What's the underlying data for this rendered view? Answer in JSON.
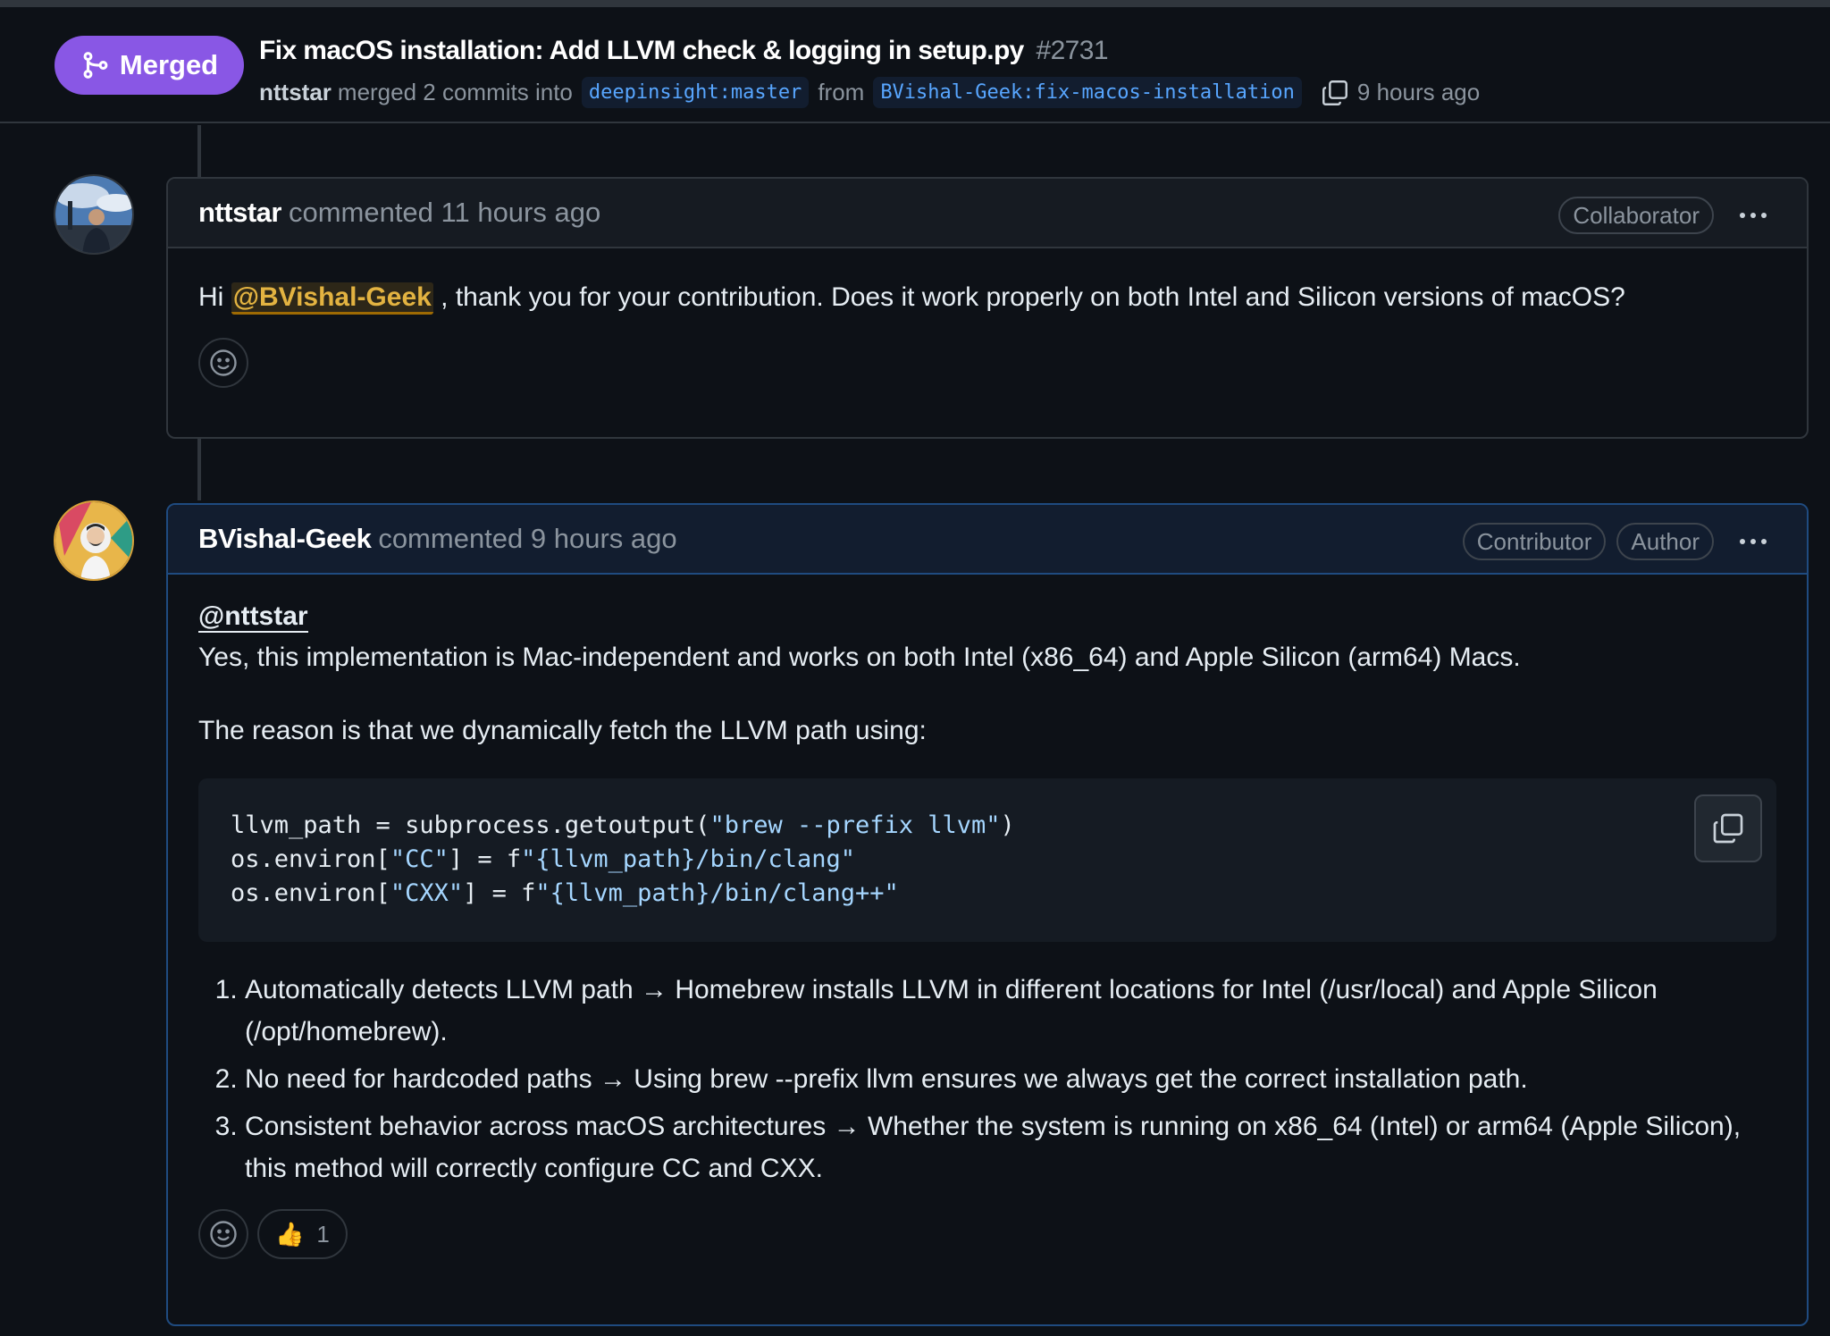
{
  "pr": {
    "status": "Merged",
    "title": "Fix macOS installation: Add LLVM check & logging in setup.py",
    "number": "#2731",
    "actor": "nttstar",
    "merged_text": "merged 2 commits into",
    "base_branch": "deepinsight:master",
    "from_text": "from",
    "head_branch": "BVishal-Geek:fix-macos-installation",
    "time": "9 hours ago"
  },
  "comments": [
    {
      "author": "nttstar",
      "verb": "commented 11 hours ago",
      "badges": [
        "Collaborator"
      ],
      "greeting": "Hi",
      "mention": "@BVishal-Geek",
      "text": ", thank you for your contribution. Does it work properly on both Intel and Silicon versions of macOS?"
    },
    {
      "author": "BVishal-Geek",
      "verb": "commented 9 hours ago",
      "badges": [
        "Contributor",
        "Author"
      ],
      "mention": "@nttstar",
      "line1": "Yes, this implementation is Mac-independent and works on both Intel (x86_64) and Apple Silicon (arm64) Macs.",
      "line2": "The reason is that we dynamically fetch the LLVM path using:",
      "code": {
        "l1_a": "llvm_path = subprocess.getoutput(",
        "l1_s": "\"brew --prefix llvm\"",
        "l1_b": ")",
        "l2_a": "os.environ[",
        "l2_s1": "\"CC\"",
        "l2_b": "] = f",
        "l2_s2": "\"{llvm_path}/bin/clang\"",
        "l3_a": "os.environ[",
        "l3_s1": "\"CXX\"",
        "l3_b": "] = f",
        "l3_s2": "\"{llvm_path}/bin/clang++\""
      },
      "points": [
        "Automatically detects LLVM path → Homebrew installs LLVM in different locations for Intel (/usr/local) and Apple Silicon (/opt/homebrew).",
        "No need for hardcoded paths → Using brew --prefix llvm ensures we always get the correct installation path.",
        "Consistent behavior across macOS architectures → Whether the system is running on x86_64 (Intel) or arm64 (Apple Silicon), this method will correctly configure CC and CXX."
      ],
      "reaction": {
        "emoji": "👍",
        "count": "1"
      }
    }
  ],
  "colors": {
    "merged": "#8957e5",
    "branch_text": "#58a6ff",
    "mention": "#e3b341",
    "background": "#0d1117"
  },
  "icons": {
    "merged_badge": "git-merge-icon",
    "copy_branch": "copy-icon",
    "menu": "kebab-menu-icon",
    "reaction": "smiley-icon",
    "code_copy": "copy-icon"
  }
}
